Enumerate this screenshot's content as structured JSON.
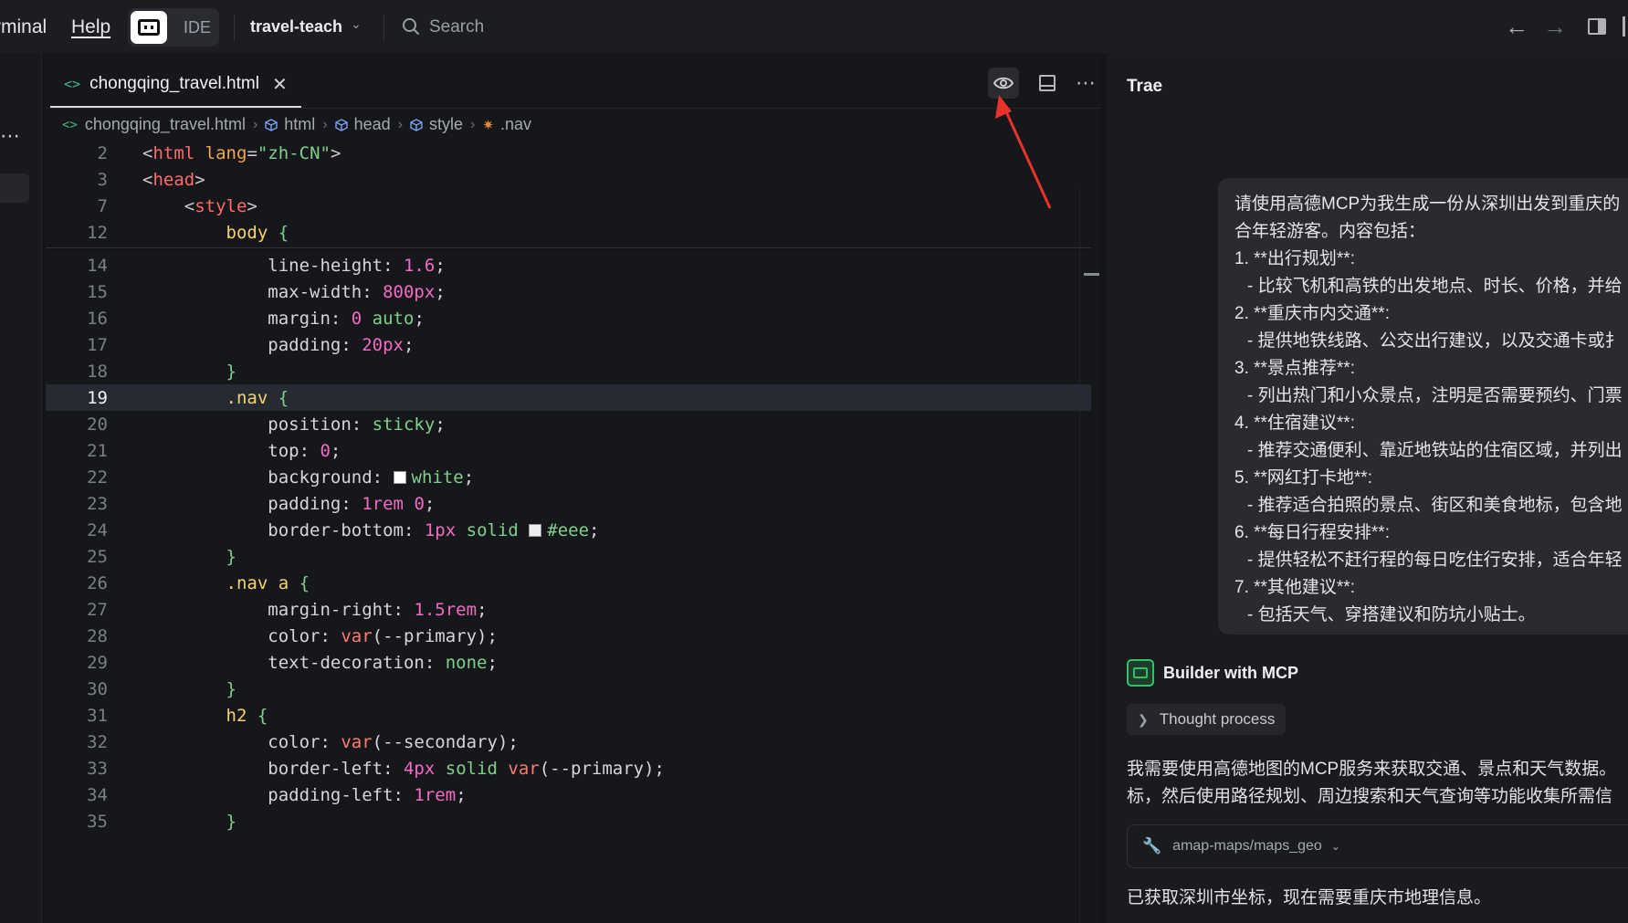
{
  "menubar": {
    "terminal": "rminal",
    "help": "Help",
    "ide_label": "IDE",
    "project": "travel-teach",
    "search_placeholder": "Search"
  },
  "editor": {
    "tab_label": "chongqing_travel.html",
    "tab_icon": "<>",
    "breadcrumb": [
      "chongqing_travel.html",
      "html",
      "head",
      "style",
      ".nav"
    ]
  },
  "code_lines": [
    {
      "n": "2",
      "segs": [
        [
          "c-br",
          "<"
        ],
        [
          "c-tag",
          "html"
        ],
        [
          "c-br",
          " "
        ],
        [
          "c-attr",
          "lang"
        ],
        [
          "c-br",
          "="
        ],
        [
          "c-str",
          "\"zh-CN\""
        ],
        [
          "c-br",
          ">"
        ]
      ]
    },
    {
      "n": "3",
      "segs": [
        [
          "c-br",
          "<"
        ],
        [
          "c-tag",
          "head"
        ],
        [
          "c-br",
          ">"
        ]
      ]
    },
    {
      "n": "7",
      "segs": [
        [
          "c-br",
          "    <"
        ],
        [
          "c-tag",
          "style"
        ],
        [
          "c-br",
          ">"
        ]
      ]
    },
    {
      "n": "12",
      "segs": [
        [
          "c-br",
          "        "
        ],
        [
          "c-sel",
          "body"
        ],
        [
          "c-kw",
          " {"
        ]
      ]
    },
    {
      "n": "14",
      "segs": [
        [
          "c-prop",
          "            line-height: "
        ],
        [
          "c-num",
          "1.6"
        ],
        [
          "c-prop",
          ";"
        ]
      ]
    },
    {
      "n": "15",
      "segs": [
        [
          "c-prop",
          "            max-width: "
        ],
        [
          "c-num",
          "800px"
        ],
        [
          "c-prop",
          ";"
        ]
      ]
    },
    {
      "n": "16",
      "segs": [
        [
          "c-prop",
          "            margin: "
        ],
        [
          "c-num",
          "0"
        ],
        [
          "c-kw",
          " auto"
        ],
        [
          "c-prop",
          ";"
        ]
      ]
    },
    {
      "n": "17",
      "segs": [
        [
          "c-prop",
          "            padding: "
        ],
        [
          "c-num",
          "20px"
        ],
        [
          "c-prop",
          ";"
        ]
      ]
    },
    {
      "n": "18",
      "segs": [
        [
          "c-kw",
          "        }"
        ]
      ]
    },
    {
      "n": "19",
      "segs": [
        [
          "c-sel",
          "        .nav"
        ],
        [
          "c-kw",
          " {"
        ]
      ]
    },
    {
      "n": "20",
      "segs": [
        [
          "c-prop",
          "            position: "
        ],
        [
          "c-kw",
          "sticky"
        ],
        [
          "c-prop",
          ";"
        ]
      ]
    },
    {
      "n": "21",
      "segs": [
        [
          "c-prop",
          "            top: "
        ],
        [
          "c-num",
          "0"
        ],
        [
          "c-prop",
          ";"
        ]
      ]
    },
    {
      "n": "22",
      "segs": [
        [
          "c-prop",
          "            background: "
        ],
        [
          "swatch",
          "#ffffff"
        ],
        [
          "c-kw",
          "white"
        ],
        [
          "c-prop",
          ";"
        ]
      ]
    },
    {
      "n": "23",
      "segs": [
        [
          "c-prop",
          "            padding: "
        ],
        [
          "c-num",
          "1rem"
        ],
        [
          "c-prop",
          " "
        ],
        [
          "c-num",
          "0"
        ],
        [
          "c-prop",
          ";"
        ]
      ]
    },
    {
      "n": "24",
      "segs": [
        [
          "c-prop",
          "            border-bottom: "
        ],
        [
          "c-num",
          "1px"
        ],
        [
          "c-kw",
          " solid "
        ],
        [
          "swatch",
          "#eeeeee"
        ],
        [
          "c-kw",
          "#eee"
        ],
        [
          "c-prop",
          ";"
        ]
      ]
    },
    {
      "n": "25",
      "segs": [
        [
          "c-kw",
          "        }"
        ]
      ]
    },
    {
      "n": "26",
      "segs": [
        [
          "c-sel",
          "        .nav a"
        ],
        [
          "c-kw",
          " {"
        ]
      ]
    },
    {
      "n": "27",
      "segs": [
        [
          "c-prop",
          "            margin-right: "
        ],
        [
          "c-num",
          "1.5rem"
        ],
        [
          "c-prop",
          ";"
        ]
      ]
    },
    {
      "n": "28",
      "segs": [
        [
          "c-prop",
          "            color: "
        ],
        [
          "c-fn",
          "var"
        ],
        [
          "c-prop",
          "(--primary);"
        ]
      ]
    },
    {
      "n": "29",
      "segs": [
        [
          "c-prop",
          "            text-decoration: "
        ],
        [
          "c-kw",
          "none"
        ],
        [
          "c-prop",
          ";"
        ]
      ]
    },
    {
      "n": "30",
      "segs": [
        [
          "c-kw",
          "        }"
        ]
      ]
    },
    {
      "n": "31",
      "segs": [
        [
          "c-sel",
          "        h2"
        ],
        [
          "c-kw",
          " {"
        ]
      ]
    },
    {
      "n": "32",
      "segs": [
        [
          "c-prop",
          "            color: "
        ],
        [
          "c-fn",
          "var"
        ],
        [
          "c-prop",
          "(--secondary);"
        ]
      ]
    },
    {
      "n": "33",
      "segs": [
        [
          "c-prop",
          "            border-left: "
        ],
        [
          "c-num",
          "4px"
        ],
        [
          "c-kw",
          " solid "
        ],
        [
          "c-fn",
          "var"
        ],
        [
          "c-prop",
          "(--primary);"
        ]
      ]
    },
    {
      "n": "34",
      "segs": [
        [
          "c-prop",
          "            padding-left: "
        ],
        [
          "c-num",
          "1rem"
        ],
        [
          "c-prop",
          ";"
        ]
      ]
    },
    {
      "n": "35",
      "segs": [
        [
          "c-kw",
          "        }"
        ]
      ]
    }
  ],
  "active_line": "19",
  "chat": {
    "title": "Trae",
    "user_message": [
      {
        "t": "请使用高德MCP为我生成一份从深圳出发到重庆的",
        "sub": false
      },
      {
        "t": "合年轻游客。内容包括：",
        "sub": false
      },
      {
        "t": "1. **出行规划**:",
        "sub": false
      },
      {
        "t": "- 比较飞机和高铁的出发地点、时长、价格，并给",
        "sub": true
      },
      {
        "t": "2. **重庆市内交通**:",
        "sub": false
      },
      {
        "t": "- 提供地铁线路、公交出行建议，以及交通卡或扌",
        "sub": true
      },
      {
        "t": "3. **景点推荐**:",
        "sub": false
      },
      {
        "t": "- 列出热门和小众景点，注明是否需要预约、门票",
        "sub": true
      },
      {
        "t": "4. **住宿建议**:",
        "sub": false
      },
      {
        "t": "- 推荐交通便利、靠近地铁站的住宿区域，并列出",
        "sub": true
      },
      {
        "t": "5. **网红打卡地**:",
        "sub": false
      },
      {
        "t": "- 推荐适合拍照的景点、街区和美食地标，包含地",
        "sub": true
      },
      {
        "t": "6. **每日行程安排**:",
        "sub": false
      },
      {
        "t": "- 提供轻松不赶行程的每日吃住行安排，适合年轻",
        "sub": true
      },
      {
        "t": "7. **其他建议**:",
        "sub": false
      },
      {
        "t": "- 包括天气、穿搭建议和防坑小贴士。",
        "sub": true
      }
    ],
    "bot_name": "Builder with MCP",
    "thought_label": "Thought process",
    "bot_text_lines": [
      "我需要使用高德地图的MCP服务来获取交通、景点和天气数据。",
      "标，然后使用路径规划、周边搜索和天气查询等功能收集所需信"
    ],
    "tool_label": "amap-maps/maps_geo",
    "bot_text_after": "已获取深圳市坐标，现在需要重庆市地理信息。"
  },
  "colors": {
    "accent_green": "#33c067",
    "annotation_red": "#e8322c"
  }
}
